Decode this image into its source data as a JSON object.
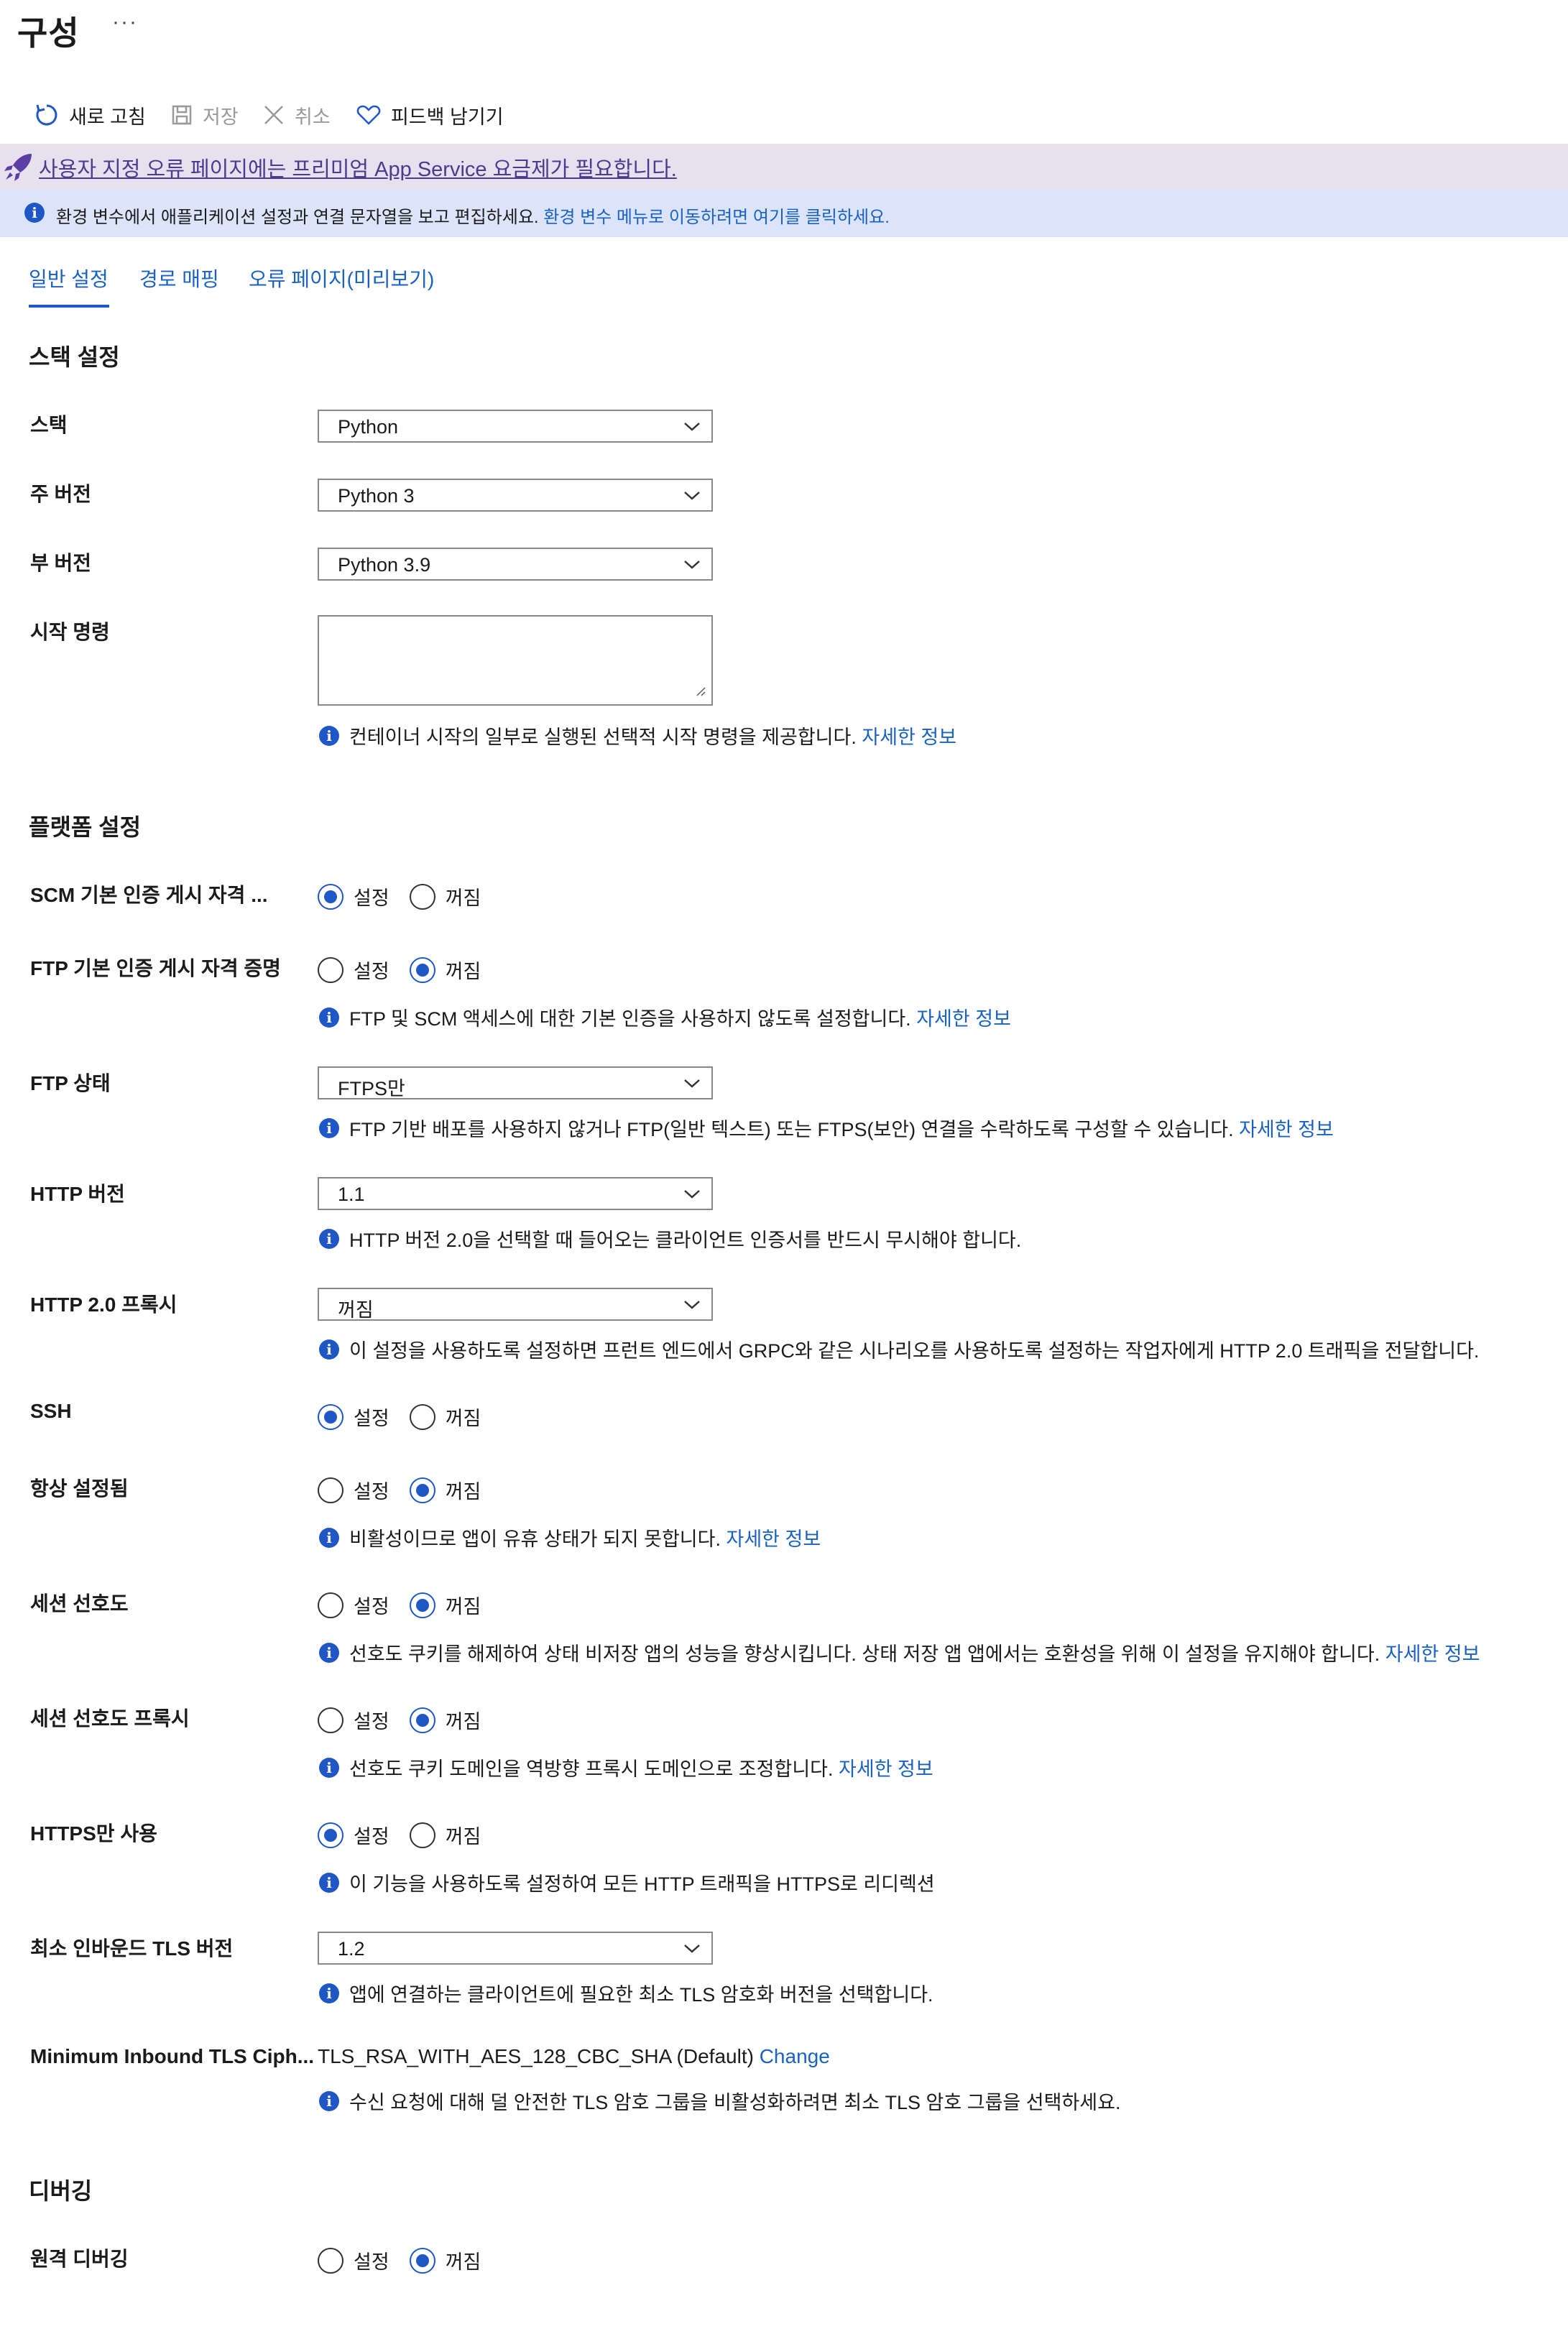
{
  "page": {
    "title": "구성",
    "more": "···"
  },
  "toolbar": {
    "refresh": "새로 고침",
    "save": "저장",
    "cancel": "취소",
    "feedback": "피드백 남기기"
  },
  "banners": {
    "premium": "사용자 지정 오류 페이지에는 프리미엄 App Service 요금제가 필요합니다.",
    "info_text": "환경 변수에서 애플리케이션 설정과 연결 문자열을 보고 편집하세요. ",
    "info_link": "환경 변수 메뉴로 이동하려면 여기를 클릭하세요."
  },
  "tabs": [
    "일반 설정",
    "경로 매핑",
    "오류 페이지(미리보기)"
  ],
  "radio": {
    "on": "설정",
    "off": "꺼짐"
  },
  "learn_more": "자세한 정보",
  "stack": {
    "section": "스택 설정",
    "stack_label": "스택",
    "stack_value": "Python",
    "major_label": "주 버전",
    "major_value": "Python 3",
    "minor_label": "부 버전",
    "minor_value": "Python 3.9",
    "startup_label": "시작 명령",
    "startup_hint": "컨테이너 시작의 일부로 실행된 선택적 시작 명령을 제공합니다."
  },
  "platform": {
    "section": "플랫폼 설정",
    "scm_label": "SCM 기본 인증 게시 자격 ...",
    "ftp_auth_label": "FTP 기본 인증 게시 자격 증명",
    "ftp_auth_hint": "FTP 및 SCM 액세스에 대한 기본 인증을 사용하지 않도록 설정합니다.",
    "ftp_state_label": "FTP 상태",
    "ftp_state_value": "FTPS만",
    "ftp_state_hint": "FTP 기반 배포를 사용하지 않거나 FTP(일반 텍스트) 또는 FTPS(보안) 연결을 수락하도록 구성할 수 있습니다.",
    "http_version_label": "HTTP 버전",
    "http_version_value": "1.1",
    "http_version_hint": "HTTP 버전 2.0을 선택할 때 들어오는 클라이언트 인증서를 반드시 무시해야 합니다.",
    "http2_proxy_label": "HTTP 2.0 프록시",
    "http2_proxy_value": "꺼짐",
    "http2_proxy_hint": "이 설정을 사용하도록 설정하면 프런트 엔드에서 GRPC와 같은 시나리오를 사용하도록 설정하는 작업자에게 HTTP 2.0 트래픽을 전달합니다.",
    "ssh_label": "SSH",
    "always_on_label": "항상 설정됨",
    "always_on_hint": "비활성이므로 앱이 유휴 상태가 되지 못합니다.",
    "affinity_label": "세션 선호도",
    "affinity_hint": "선호도 쿠키를 해제하여 상태 비저장 앱의 성능을 향상시킵니다. 상태 저장 앱 앱에서는 호환성을 위해 이 설정을 유지해야 합니다.",
    "affinity_proxy_label": "세션 선호도 프록시",
    "affinity_proxy_hint": "선호도 쿠키 도메인을 역방향 프록시 도메인으로 조정합니다.",
    "https_only_label": "HTTPS만 사용",
    "https_only_hint": "이 기능을 사용하도록 설정하여 모든 HTTP 트래픽을 HTTPS로 리디렉션",
    "tls_label": "최소 인바운드 TLS 버전",
    "tls_value": "1.2",
    "tls_hint": "앱에 연결하는 클라이언트에 필요한 최소 TLS 암호화 버전을 선택합니다.",
    "cipher_label": "Minimum Inbound TLS Ciph...",
    "cipher_value": "TLS_RSA_WITH_AES_128_CBC_SHA (Default)",
    "cipher_change": "Change",
    "cipher_hint": "수신 요청에 대해 덜 안전한 TLS 암호 그룹을 비활성화하려면 최소 TLS 암호 그룹을 선택하세요."
  },
  "debugging": {
    "section": "디버깅",
    "remote_label": "원격 디버깅"
  },
  "colors": {
    "accent": "#1f57c7",
    "link": "#1a61c4",
    "premium_banner": "#e7e0ef",
    "info_banner": "#dbe4fa"
  }
}
